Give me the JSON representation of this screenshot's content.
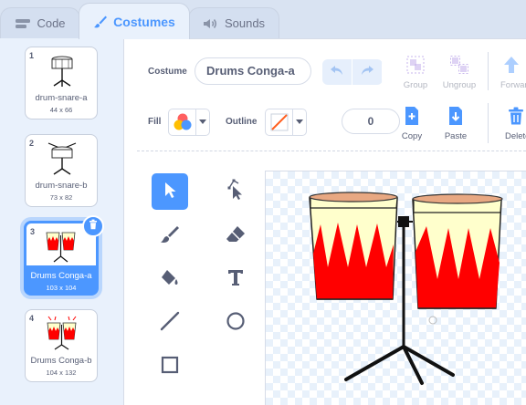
{
  "tabs": [
    {
      "label": "Code",
      "icon": "code-icon"
    },
    {
      "label": "Costumes",
      "icon": "brush-icon"
    },
    {
      "label": "Sounds",
      "icon": "speaker-icon"
    }
  ],
  "costumes": [
    {
      "number": "1",
      "name": "drum-snare-a",
      "size": "44 x 66"
    },
    {
      "number": "2",
      "name": "drum-snare-b",
      "size": "73 x 82"
    },
    {
      "number": "3",
      "name": "Drums Conga-a",
      "size": "103 x 104"
    },
    {
      "number": "4",
      "name": "Drums Conga-b",
      "size": "104 x 132"
    }
  ],
  "editor": {
    "costume_label": "Costume",
    "costume_name": "Drums Conga-a",
    "group_label": "Group",
    "ungroup_label": "Ungroup",
    "forward_label": "Forward",
    "fill_label": "Fill",
    "outline_label": "Outline",
    "outline_width": "0",
    "copy_label": "Copy",
    "paste_label": "Paste",
    "delete_label": "Delete"
  },
  "colors": {
    "accent": "#4c97ff",
    "drum_red": "#ff0000",
    "drum_cream": "#ffffcc",
    "text": "#575e75"
  }
}
